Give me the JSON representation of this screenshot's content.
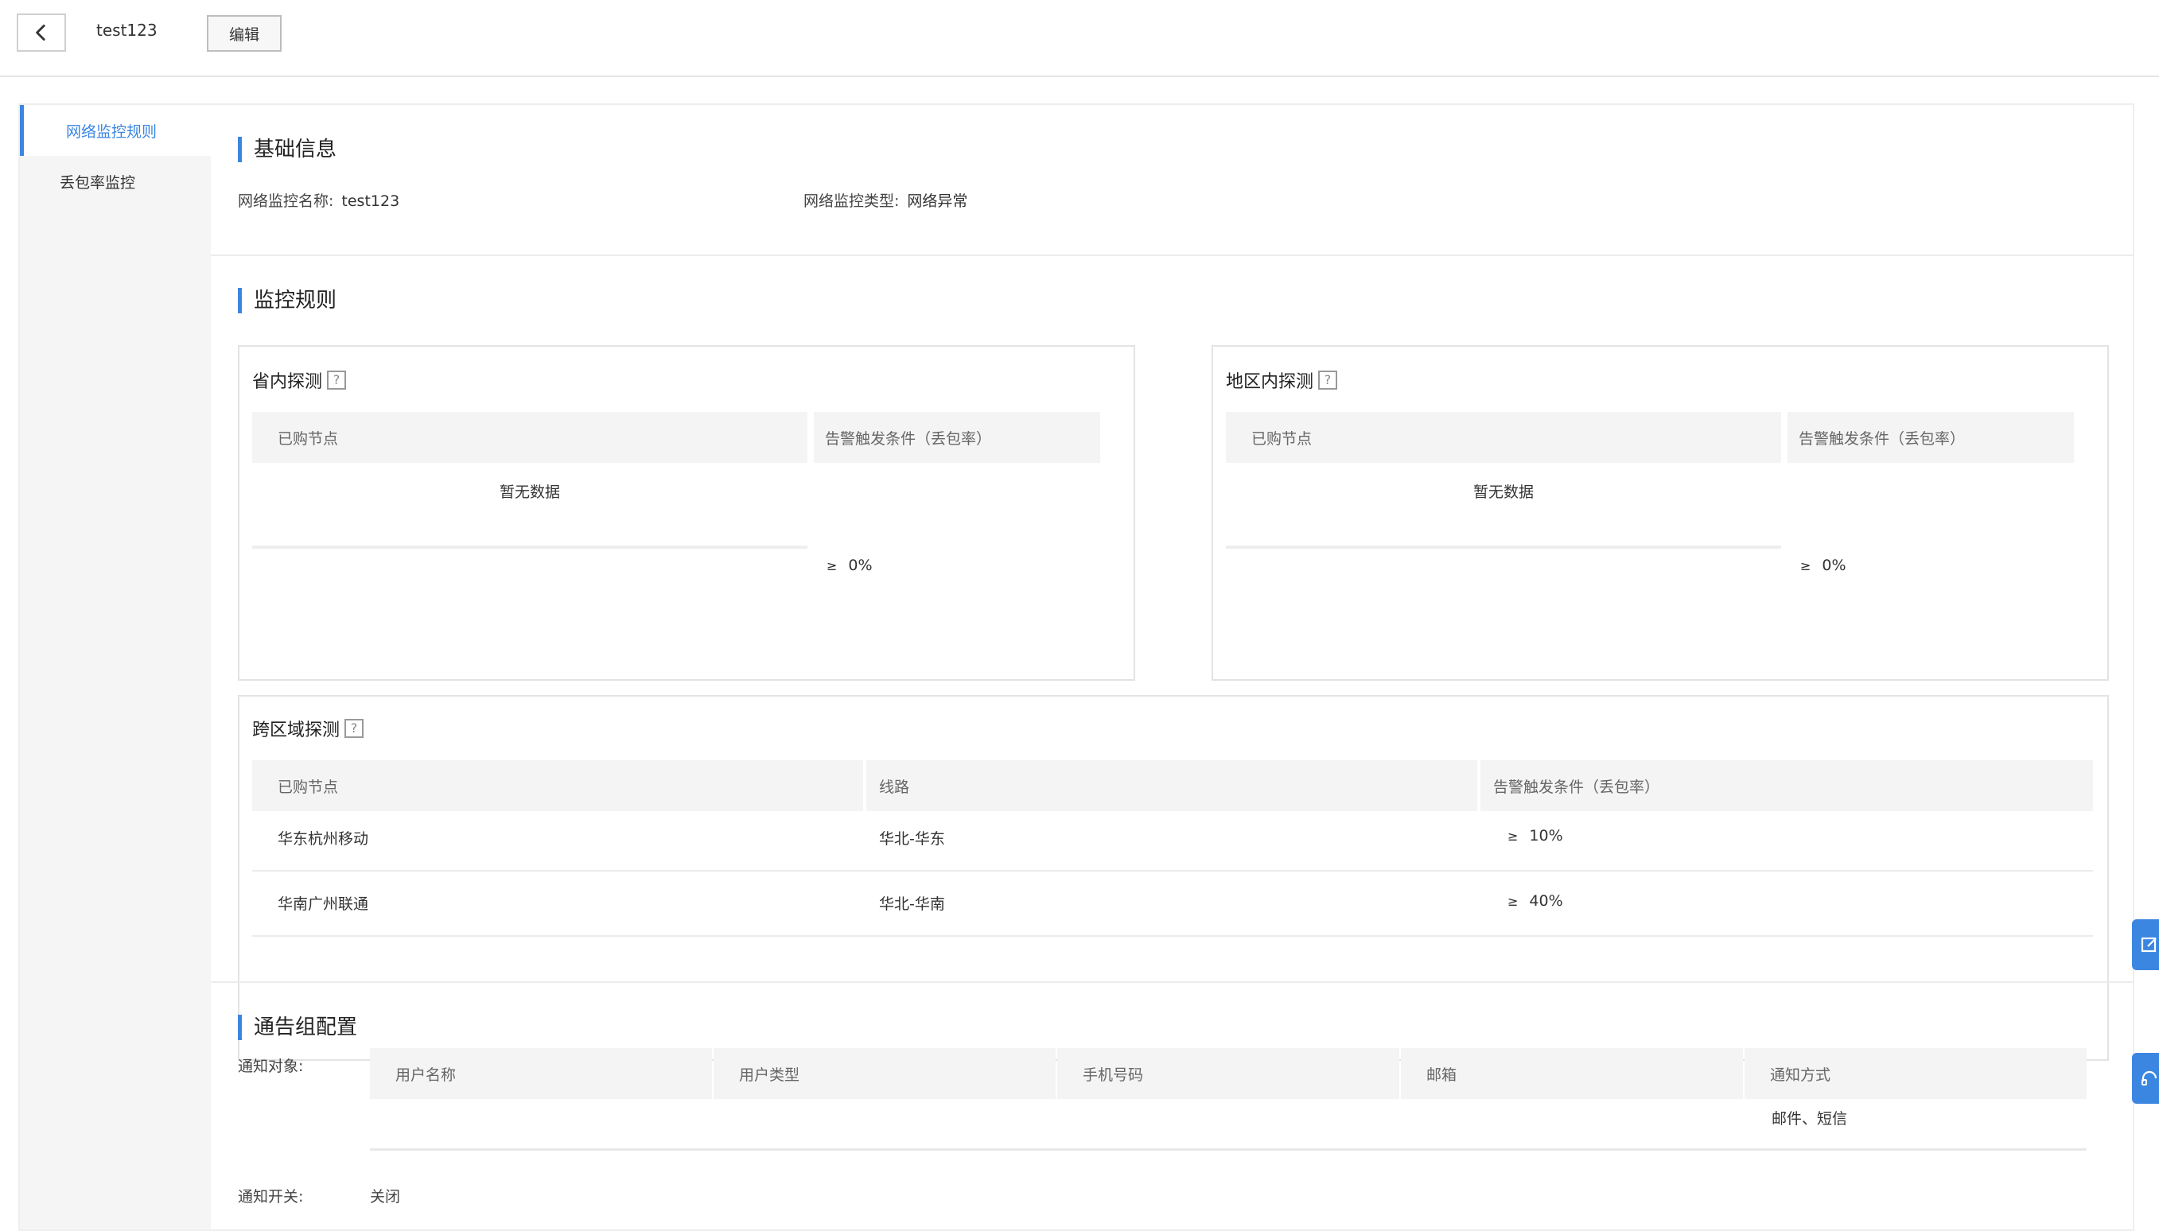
{
  "header": {
    "title": "test123",
    "edit_label": "编辑"
  },
  "sidebar": {
    "items": [
      {
        "label": "网络监控规则"
      },
      {
        "label": "丢包率监控"
      }
    ]
  },
  "basic_info": {
    "title": "基础信息",
    "name_label": "网络监控名称:",
    "name_value": "test123",
    "type_label": "网络监控类型:",
    "type_value": "网络异常"
  },
  "rules": {
    "title": "监控规则",
    "province": {
      "title": "省内探测",
      "help": "?",
      "col_nodes": "已购节点",
      "col_condition": "告警触发条件（丢包率）",
      "empty": "暂无数据",
      "ge": "≥",
      "threshold": "0%"
    },
    "region": {
      "title": "地区内探测",
      "help": "?",
      "col_nodes": "已购节点",
      "col_condition": "告警触发条件（丢包率）",
      "empty": "暂无数据",
      "ge": "≥",
      "threshold": "0%"
    },
    "cross": {
      "title": "跨区域探测",
      "help": "?",
      "col_nodes": "已购节点",
      "col_route": "线路",
      "col_condition": "告警触发条件（丢包率）",
      "rows": [
        {
          "node": "华东杭州移动",
          "route": "华北-华东",
          "ge": "≥",
          "threshold": "10%"
        },
        {
          "node": "华南广州联通",
          "route": "华北-华南",
          "ge": "≥",
          "threshold": "40%"
        }
      ]
    }
  },
  "notify": {
    "title": "通告组配置",
    "target_label": "通知对象:",
    "columns": [
      "用户名称",
      "用户类型",
      "手机号码",
      "邮箱",
      "通知方式"
    ],
    "rows": [
      {
        "name": "",
        "type": "",
        "phone": "",
        "email": "",
        "method": "邮件、短信"
      }
    ],
    "switch_label": "通知开关:",
    "switch_value": "关闭"
  },
  "floating": {
    "edit_icon": "edit-icon",
    "headset_icon": "headset-icon"
  },
  "colors": {
    "accent": "#3b86e0",
    "sidebar_bg": "#f5f5f5",
    "table_header_bg": "#f4f4f4"
  }
}
